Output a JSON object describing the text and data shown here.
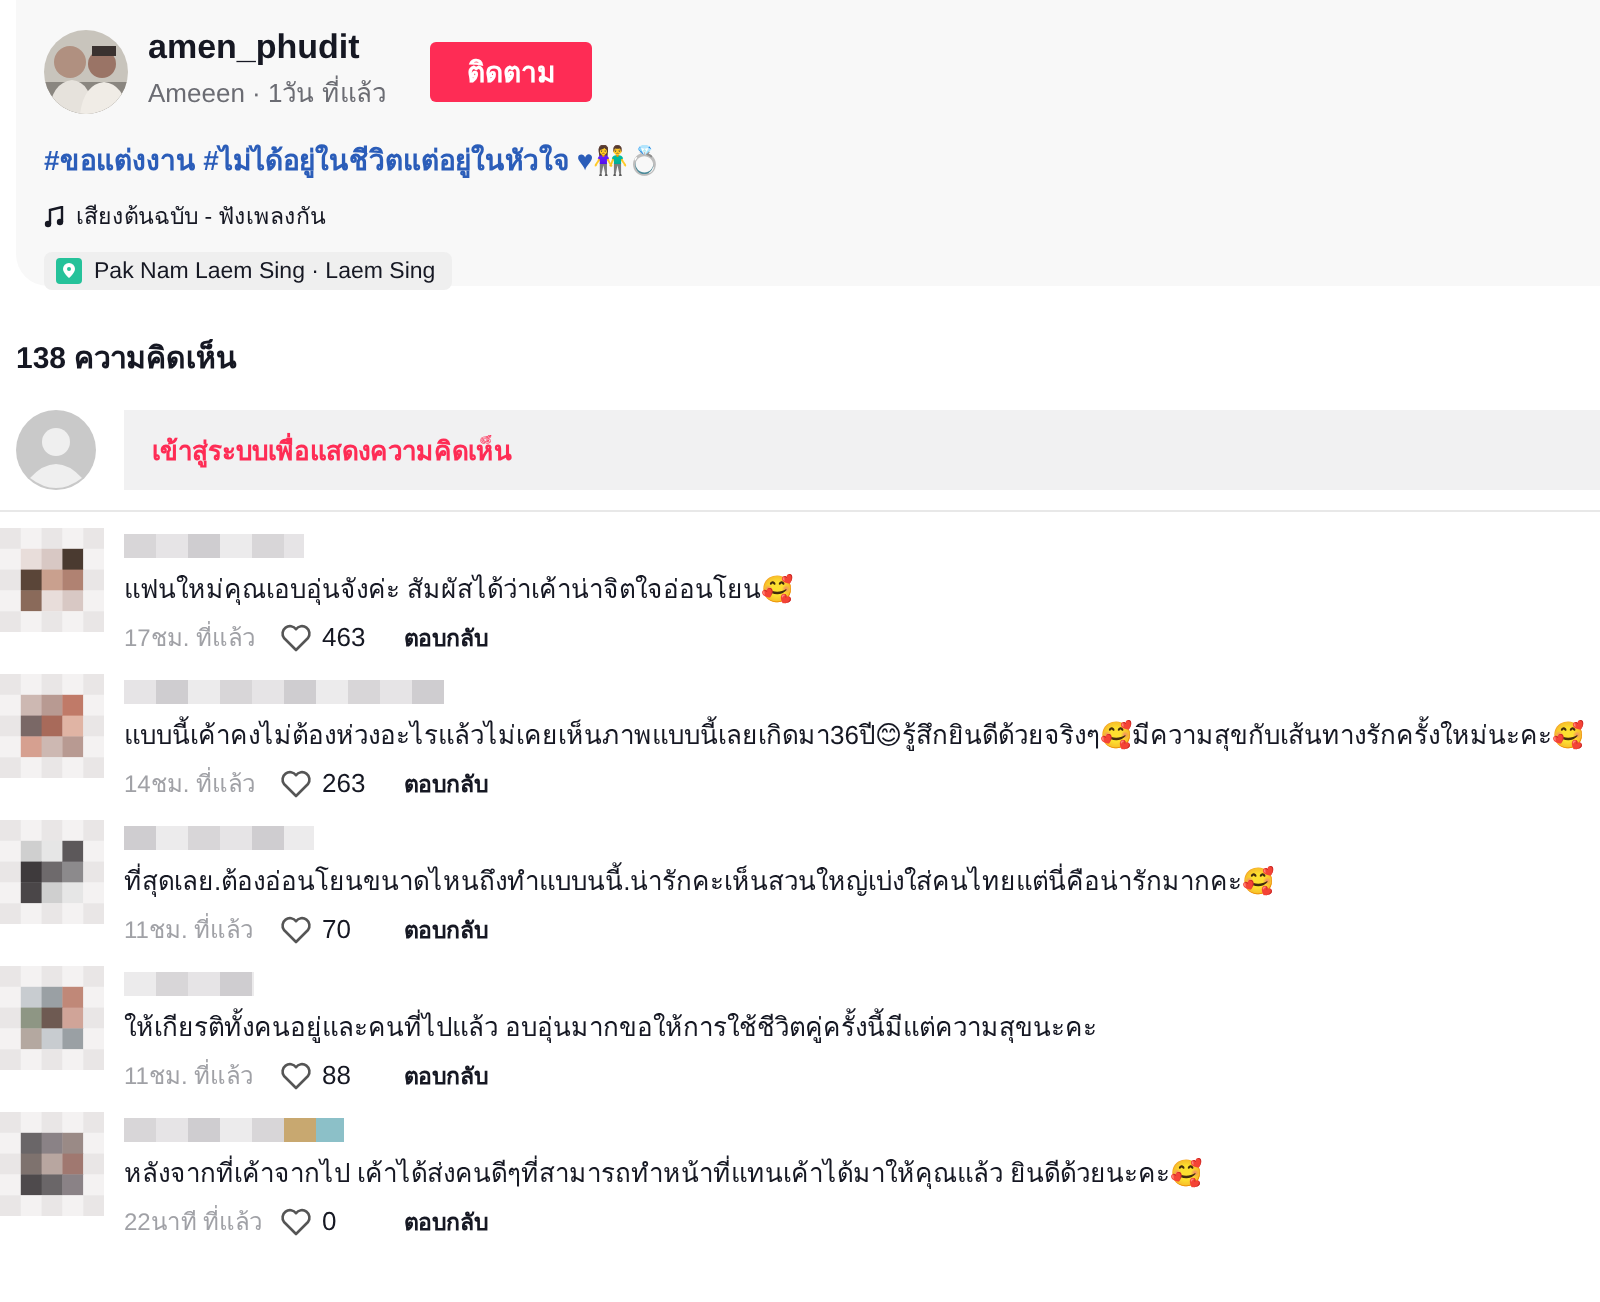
{
  "post": {
    "username": "amen_phudit",
    "subtitle": "Ameeen · 1วัน ที่แล้ว",
    "follow_button": "ติดตาม",
    "caption": "#ขอแต่งงาน #ไม่ได้อยู่ในชีวิตแต่อยู่ในหัวใจ ♥👫💍",
    "music": "เสียงต้นฉบับ - ฟังเพลงกัน",
    "location": "Pak Nam Laem Sing · Laem Sing"
  },
  "comments_header": "138 ความคิดเห็น",
  "login_prompt": "เข้าสู่ระบบเพื่อแสดงความคิดเห็น",
  "comments": [
    {
      "text": "แฟนใหม่คุณเอบอุ่นจังค่ะ สัมผัสได้ว่าเค้าน่าจิตใจอ่อนโยน🥰",
      "time": "17ชม. ที่แล้ว",
      "likes": "463",
      "reply": "ตอบกลับ"
    },
    {
      "text": "แบบนี้เค้าคงไม่ต้องห่วงอะไรแล้วไม่เคยเห็นภาพแบบนี้เลยเกิดมา36ปี😊รู้สึกยินดีด้วยจริงๆ🥰มีความสุขกับเส้นทางรักครั้งใหม่นะคะ🥰",
      "time": "14ชม. ที่แล้ว",
      "likes": "263",
      "reply": "ตอบกลับ"
    },
    {
      "text": "ที่สุดเลย.ต้องอ่อนโยนขนาดไหนถึงทำแบบนนี้.น่ารักคะเห็นสวนใหญ่เบ่งใส่คนไทยแต่นี่คือน่ารักมากคะ🥰",
      "time": "11ชม. ที่แล้ว",
      "likes": "70",
      "reply": "ตอบกลับ"
    },
    {
      "text": "ให้เกียรติทั้งคนอยู่และคนที่ไปแล้ว อบอุ่นมากขอให้การใช้ชีวิตคู่ครั้งนี้มีแต่ความสุขนะคะ",
      "time": "11ชม. ที่แล้ว",
      "likes": "88",
      "reply": "ตอบกลับ"
    },
    {
      "text": "หลังจากที่เค้าจากไป เค้าได้ส่งคนดีๆที่สามารถทำหน้าที่แทนเค้าได้มาให้คุณแล้ว ยินดีด้วยนะคะ🥰",
      "time": "22นาที ที่แล้ว",
      "likes": "0",
      "reply": "ตอบกลับ"
    }
  ]
}
